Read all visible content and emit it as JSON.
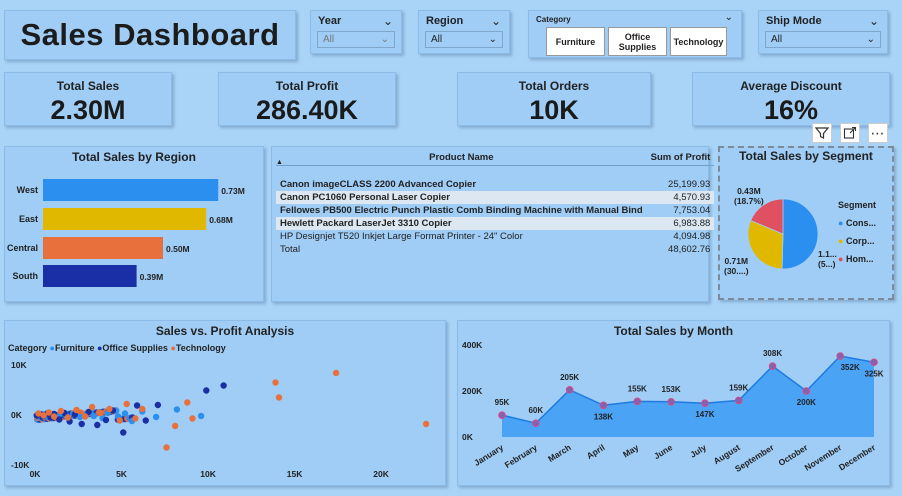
{
  "header": {
    "title": "Sales Dashboard"
  },
  "slicers": {
    "year": {
      "label": "Year",
      "value": "All"
    },
    "region": {
      "label": "Region",
      "value": "All"
    },
    "category": {
      "label": "Category",
      "options": [
        "Furniture",
        "Office Supplies",
        "Technology"
      ]
    },
    "ship_mode": {
      "label": "Ship Mode",
      "value": "All"
    }
  },
  "kpis": [
    {
      "label": "Total Sales",
      "value": "2.30M"
    },
    {
      "label": "Total Profit",
      "value": "286.40K"
    },
    {
      "label": "Total Orders",
      "value": "10K"
    },
    {
      "label": "Average Discount",
      "value": "16%"
    }
  ],
  "visual_toolbar": {
    "icons": [
      "filter-icon",
      "focus-mode-icon",
      "more-options-icon"
    ]
  },
  "region_chart": {
    "title": "Total Sales by Region",
    "categories": [
      "West",
      "East",
      "Central",
      "South"
    ],
    "labels": [
      "0.73M",
      "0.68M",
      "0.50M",
      "0.39M"
    ],
    "colors": [
      "#2b8ff0",
      "#e0b800",
      "#e8703c",
      "#1a2fa6"
    ]
  },
  "product_table": {
    "headers": [
      "Product Name",
      "Sum of Profit"
    ],
    "rows": [
      [
        "Canon imageCLASS 2200 Advanced Copier",
        "25,199.93"
      ],
      [
        "Canon PC1060 Personal Laser Copier",
        "4,570.93"
      ],
      [
        "Fellowes PB500 Electric Punch Plastic Comb Binding Machine with Manual Bind",
        "7,753.04"
      ],
      [
        "Hewlett Packard LaserJet 3310 Copier",
        "6,983.88"
      ],
      [
        "HP Designjet T520 Inkjet Large Format Printer - 24\" Color",
        "4,094.98"
      ]
    ],
    "total": [
      "Total",
      "48,602.76"
    ]
  },
  "segment_chart": {
    "title": "Total Sales by Segment",
    "legend_title": "Segment",
    "legend": [
      "Cons...",
      "Corp...",
      "Hom..."
    ],
    "colors": [
      "#2b8ff0",
      "#e0b800",
      "#e05060"
    ],
    "labels": {
      "top": [
        "0.43M",
        "(18.7%)"
      ],
      "right": [
        "1.1...",
        "(5...)"
      ],
      "bottom": [
        "0.71M",
        "(30....)"
      ]
    }
  },
  "scatter_chart": {
    "title": "Sales vs. Profit Analysis",
    "legend_title": "Category",
    "legend": [
      {
        "name": "Furniture",
        "color": "#2b8ff0"
      },
      {
        "name": "Office Supplies",
        "color": "#1a2fa6"
      },
      {
        "name": "Technology",
        "color": "#e8703c"
      }
    ],
    "y_ticks": [
      "10K",
      "0K",
      "-10K"
    ],
    "x_ticks": [
      "0K",
      "5K",
      "10K",
      "15K",
      "20K"
    ]
  },
  "chart_data": [
    {
      "type": "bar",
      "title": "Total Sales by Region",
      "categories": [
        "West",
        "East",
        "Central",
        "South"
      ],
      "values": [
        0.73,
        0.68,
        0.5,
        0.39
      ],
      "unit": "M"
    },
    {
      "type": "pie",
      "title": "Total Sales by Segment",
      "categories": [
        "Cons...",
        "Corp...",
        "Hom..."
      ],
      "values": [
        1.16,
        0.71,
        0.43
      ],
      "unit": "M"
    },
    {
      "type": "scatter",
      "title": "Sales vs. Profit Analysis",
      "xlim": [
        0,
        23000
      ],
      "ylim": [
        -10000,
        10000
      ],
      "series": [
        {
          "name": "Furniture",
          "points": [
            [
              200,
              0
            ],
            [
              400,
              200
            ],
            [
              600,
              -300
            ],
            [
              900,
              100
            ],
            [
              1200,
              -200
            ],
            [
              1500,
              300
            ],
            [
              1800,
              -100
            ],
            [
              2200,
              200
            ],
            [
              2600,
              -400
            ],
            [
              3000,
              100
            ],
            [
              3400,
              -200
            ],
            [
              3900,
              -600
            ],
            [
              4200,
              400
            ],
            [
              4800,
              -300
            ],
            [
              5200,
              300
            ],
            [
              5600,
              -1200
            ],
            [
              6200,
              700
            ],
            [
              7000,
              -400
            ],
            [
              8200,
              1100
            ],
            [
              9600,
              -200
            ]
          ]
        },
        {
          "name": "Office Supplies",
          "points": [
            [
              100,
              -100
            ],
            [
              300,
              100
            ],
            [
              500,
              -200
            ],
            [
              700,
              300
            ],
            [
              900,
              -500
            ],
            [
              1100,
              200
            ],
            [
              1400,
              -900
            ],
            [
              1700,
              400
            ],
            [
              2000,
              -1300
            ],
            [
              2300,
              100
            ],
            [
              2700,
              -1800
            ],
            [
              3100,
              600
            ],
            [
              3600,
              -2000
            ],
            [
              4100,
              -1000
            ],
            [
              4500,
              900
            ],
            [
              5100,
              -3500
            ],
            [
              5900,
              1900
            ],
            [
              6400,
              -1100
            ],
            [
              7100,
              2000
            ],
            [
              9900,
              4900
            ],
            [
              10900,
              5900
            ]
          ]
        },
        {
          "name": "Technology",
          "points": [
            [
              200,
              300
            ],
            [
              500,
              -100
            ],
            [
              800,
              500
            ],
            [
              1100,
              -300
            ],
            [
              1500,
              800
            ],
            [
              1900,
              -500
            ],
            [
              2400,
              1000
            ],
            [
              2900,
              -300
            ],
            [
              3300,
              1600
            ],
            [
              3800,
              400
            ],
            [
              4300,
              1200
            ],
            [
              4900,
              -1100
            ],
            [
              5300,
              2200
            ],
            [
              5800,
              -700
            ],
            [
              6200,
              1200
            ],
            [
              7600,
              -6500
            ],
            [
              8100,
              -2200
            ],
            [
              8800,
              2500
            ],
            [
              9100,
              -700
            ],
            [
              13900,
              6500
            ],
            [
              14100,
              3500
            ],
            [
              17400,
              8400
            ],
            [
              22600,
              -1800
            ]
          ]
        }
      ]
    },
    {
      "type": "area",
      "title": "Total Sales by Month",
      "categories": [
        "January",
        "February",
        "March",
        "April",
        "May",
        "June",
        "July",
        "August",
        "September",
        "October",
        "November",
        "December"
      ],
      "values": [
        95,
        60,
        205,
        138,
        155,
        153,
        147,
        159,
        308,
        200,
        352,
        325
      ],
      "unit": "K",
      "ylim": [
        0,
        400
      ],
      "y_ticks": [
        "400K",
        "200K",
        "0K"
      ]
    }
  ],
  "month_chart": {
    "title": "Total Sales by Month",
    "labels": [
      "95K",
      "60K",
      "205K",
      "138K",
      "155K",
      "153K",
      "147K",
      "159K",
      "308K",
      "200K",
      "352K",
      "325K"
    ],
    "y_ticks": [
      "400K",
      "200K",
      "0K"
    ]
  }
}
